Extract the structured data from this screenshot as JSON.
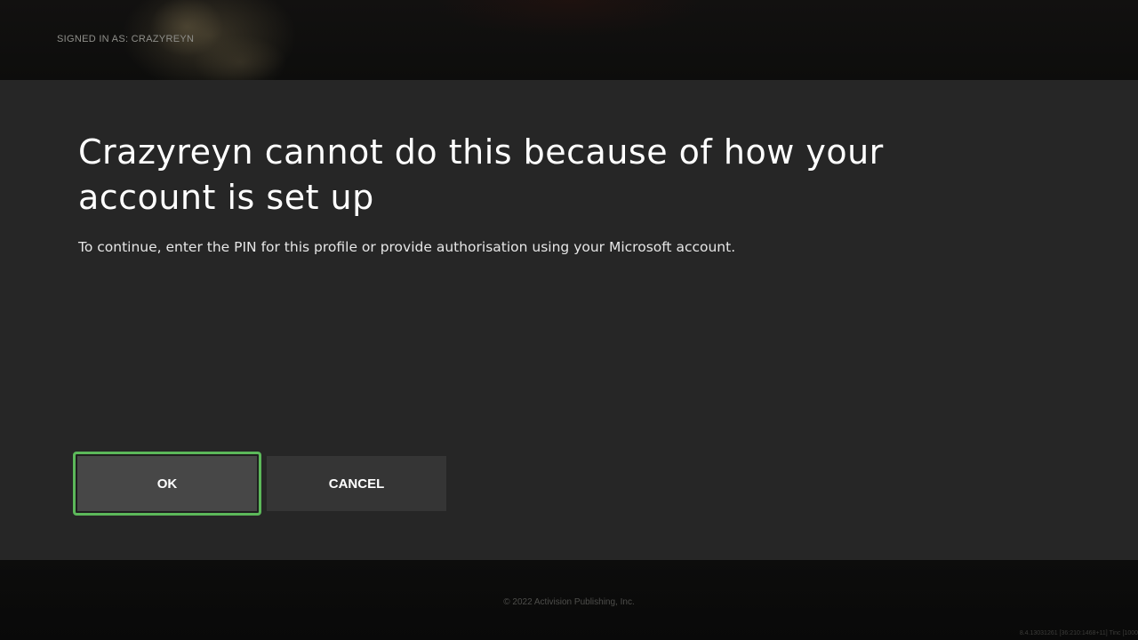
{
  "header": {
    "signed_in_text": "SIGNED IN AS: CRAZYREYN"
  },
  "dialog": {
    "title": "Crazyreyn cannot do this because of how your account is set up",
    "message": "To continue, enter the PIN for this profile or provide authorisation using your Microsoft account.",
    "buttons": {
      "ok_label": "OK",
      "cancel_label": "CANCEL"
    },
    "focused_button": "OK"
  },
  "footer": {
    "copyright": "© 2022 Activision Publishing, Inc.",
    "version": "8.4.13031261 [36:210:1468+11] Tinc [1000"
  },
  "colors": {
    "dialog_background": "#262626",
    "focus_outline": "#5cb85a",
    "ok_button": "#474747",
    "cancel_button": "#353535",
    "text": "#ffffff"
  }
}
